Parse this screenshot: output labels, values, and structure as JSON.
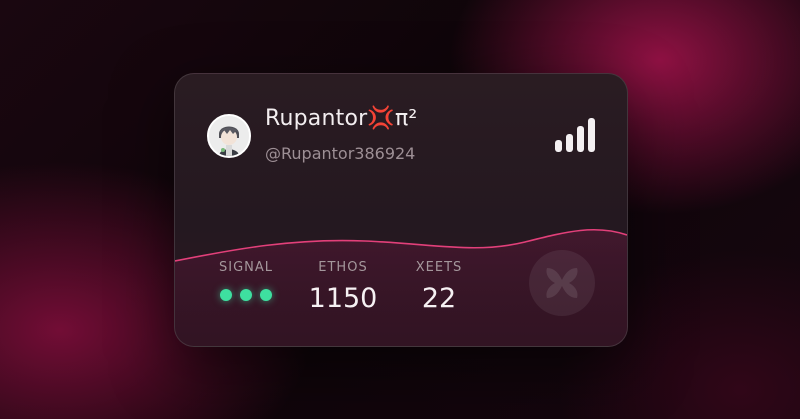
{
  "profile": {
    "display_name": "Rupantor💢π²",
    "handle": "@Rupantor386924"
  },
  "stats": {
    "signal": {
      "label": "SIGNAL",
      "level_filled": 3,
      "level_max": 3
    },
    "ethos": {
      "label": "ETHOS",
      "value": "1150"
    },
    "xeets": {
      "label": "XEETS",
      "value": "22"
    }
  },
  "connection_strength": {
    "filled_bars": 4,
    "total_bars": 4
  },
  "icons": {
    "avatar": "anime-avatar",
    "signal_strength": "signal-bars-icon",
    "brand_logo": "brand-logo-watermark"
  },
  "colors": {
    "accent_wave": "#e2407a",
    "signal_dot": "#3ee0a0",
    "text_primary": "#f3eef0",
    "text_secondary": "#9d8f95"
  }
}
